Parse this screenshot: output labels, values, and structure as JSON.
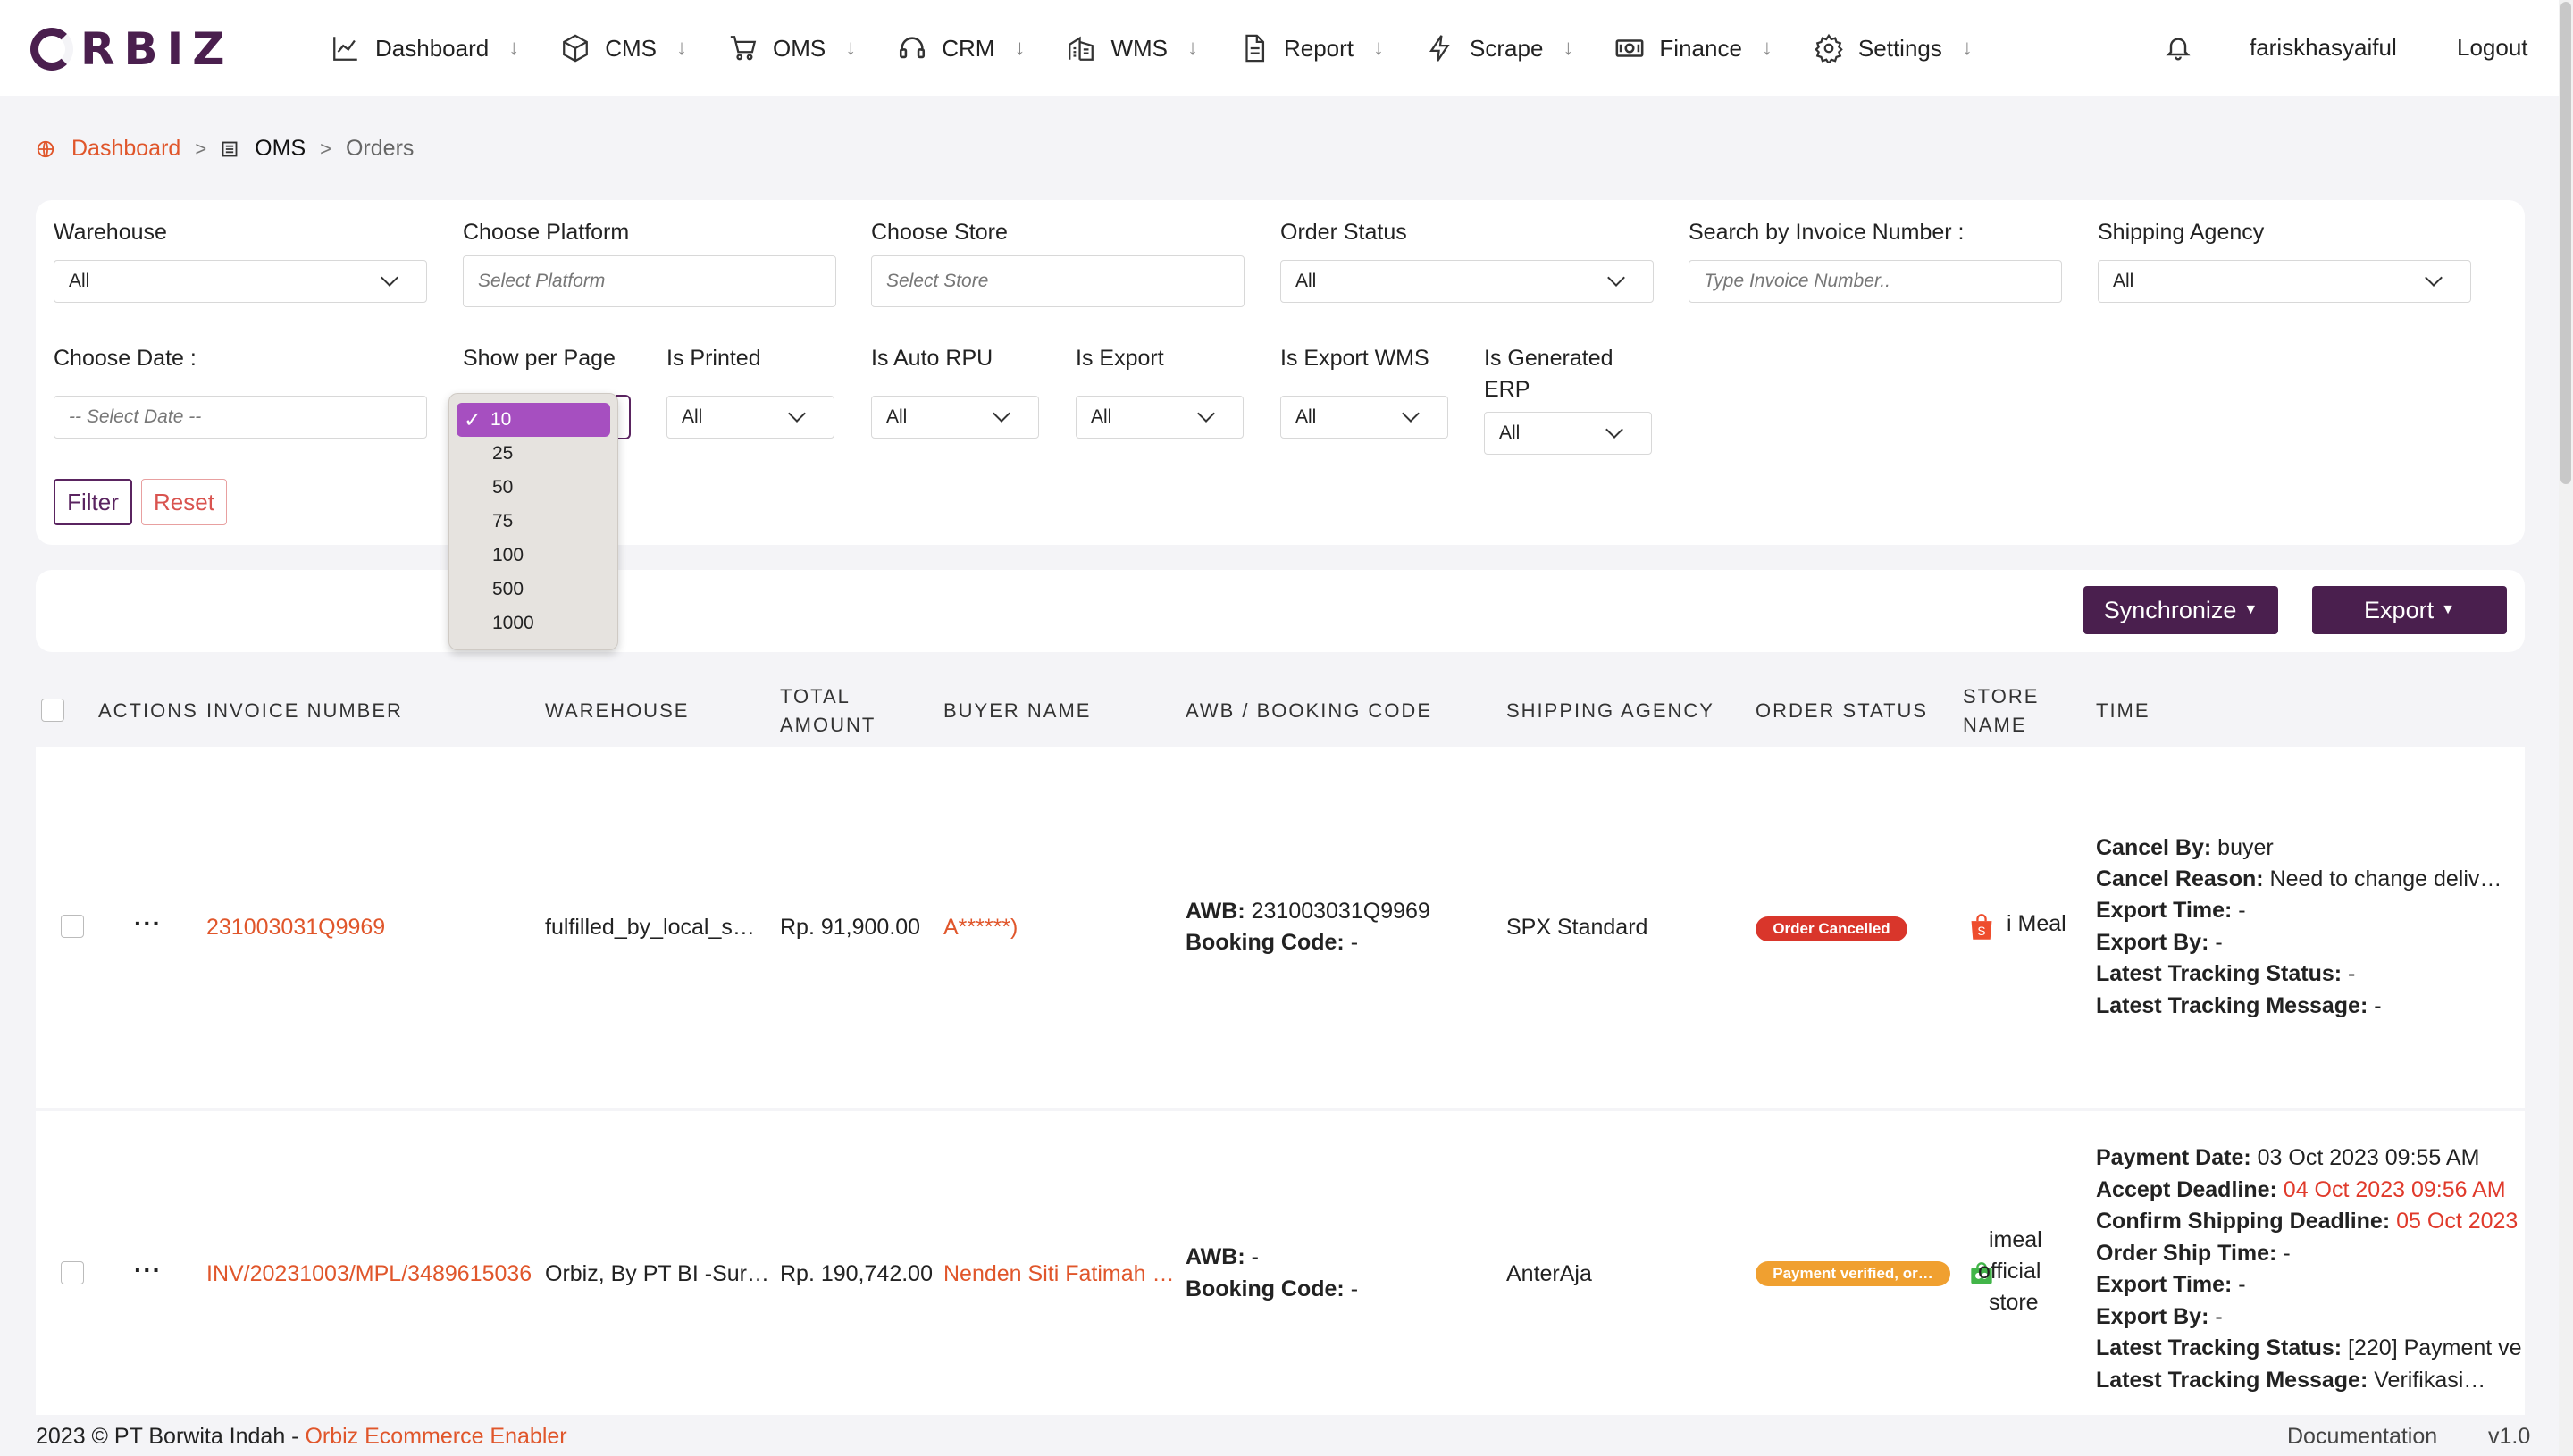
{
  "brand": {
    "logo_text": "RBIZ",
    "color": "#4a1f4e"
  },
  "nav": {
    "items": [
      {
        "label": "Dashboard",
        "icon": "chart-line-icon"
      },
      {
        "label": "CMS",
        "icon": "box-icon"
      },
      {
        "label": "OMS",
        "icon": "cart-icon"
      },
      {
        "label": "CRM",
        "icon": "headset-icon"
      },
      {
        "label": "WMS",
        "icon": "warehouse-icon"
      },
      {
        "label": "Report",
        "icon": "document-icon"
      },
      {
        "label": "Scrape",
        "icon": "bolt-icon"
      },
      {
        "label": "Finance",
        "icon": "money-icon"
      },
      {
        "label": "Settings",
        "icon": "gear-icon"
      }
    ],
    "arrow": "↓",
    "username": "fariskhasyaiful",
    "logout": "Logout"
  },
  "breadcrumb": {
    "home": "Dashboard",
    "section": "OMS",
    "current": "Orders",
    "sep": ">"
  },
  "filters": {
    "warehouse": {
      "label": "Warehouse",
      "value": "All"
    },
    "platform": {
      "label": "Choose Platform",
      "placeholder": "Select Platform"
    },
    "store": {
      "label": "Choose Store",
      "placeholder": "Select Store"
    },
    "order_status": {
      "label": "Order Status",
      "value": "All"
    },
    "invoice": {
      "label": "Search by Invoice Number :",
      "placeholder": "Type Invoice Number.."
    },
    "shipping_agency": {
      "label": "Shipping Agency",
      "value": "All"
    },
    "date": {
      "label": "Choose Date :",
      "placeholder": "-- Select Date --"
    },
    "per_page": {
      "label": "Show per Page",
      "options": [
        "10",
        "25",
        "50",
        "75",
        "100",
        "500",
        "1000"
      ],
      "selected": "10",
      "check": "✓"
    },
    "is_printed": {
      "label": "Is Printed",
      "value": "All"
    },
    "is_auto_rpu": {
      "label": "Is Auto RPU",
      "value": "All"
    },
    "is_export": {
      "label": "Is Export",
      "value": "All"
    },
    "is_export_wms": {
      "label": "Is Export WMS",
      "value": "All"
    },
    "is_generated_erp": {
      "label_line1": "Is Generated",
      "label_line2": "ERP",
      "value": "All"
    },
    "filter_button": "Filter",
    "reset_button": "Reset"
  },
  "actions": {
    "synchronize": "Synchronize",
    "export": "Export"
  },
  "table": {
    "headers": {
      "actions": "ACTIONS",
      "invoice": "INVOICE NUMBER",
      "warehouse": "WAREHOUSE",
      "total_1": "TOTAL",
      "total_2": "AMOUNT",
      "buyer": "BUYER NAME",
      "awb": "AWB / BOOKING CODE",
      "shipping": "SHIPPING AGENCY",
      "status": "ORDER STATUS",
      "store_1": "STORE",
      "store_2": "NAME",
      "time": "TIME"
    },
    "rows": [
      {
        "invoice": "231003031Q9969",
        "warehouse": "fulfilled_by_local_s…",
        "total": "Rp. 91,900.00",
        "buyer": "A******)",
        "awb_label": "AWB:",
        "awb": "231003031Q9969",
        "booking_label": "Booking Code:",
        "booking": "-",
        "shipping": "SPX Standard",
        "status": "Order Cancelled",
        "status_color": "#d9362b",
        "store": "i Meal",
        "store_icon": "shopee-bag-icon",
        "time": [
          {
            "k": "Cancel By:",
            "v": "buyer"
          },
          {
            "k": "Cancel Reason:",
            "v": "Need to change deliv…"
          },
          {
            "k": "Export Time:",
            "v": "-"
          },
          {
            "k": "Export By:",
            "v": "-"
          },
          {
            "k": "Latest Tracking Status:",
            "v": "-"
          },
          {
            "k": "Latest Tracking Message:",
            "v": "-"
          }
        ]
      },
      {
        "invoice": "INV/20231003/MPL/3489615036",
        "warehouse": "Orbiz, By PT BI -Sur…",
        "total": "Rp. 190,742.00",
        "buyer": "Nenden Siti Fatimah …",
        "awb_label": "AWB:",
        "awb": "-",
        "booking_label": "Booking Code:",
        "booking": "-",
        "shipping": "AnterAja",
        "status": "Payment verified, or…",
        "status_color": "#f0a030",
        "store_line1": "imeal",
        "store_line2": "official",
        "store_line3": "store",
        "store_icon": "tokopedia-icon",
        "time": [
          {
            "k": "Payment Date:",
            "v": "03 Oct 2023 09:55 AM"
          },
          {
            "k": "Accept Deadline:",
            "v": "04 Oct 2023 09:56 AM"
          },
          {
            "k": "Confirm Shipping Deadline:",
            "v": "05 Oct 2023"
          },
          {
            "k": "Order Ship Time:",
            "v": "-"
          },
          {
            "k": "Export Time:",
            "v": "-"
          },
          {
            "k": "Export By:",
            "v": "-"
          },
          {
            "k": "Latest Tracking Status:",
            "v": "[220] Payment ve"
          },
          {
            "k": "Latest Tracking Message:",
            "v": "Verifikasi…"
          }
        ]
      }
    ]
  },
  "footer": {
    "copyright": "2023 © PT Borwita Indah - ",
    "company_link": "Orbiz Ecommerce Enabler",
    "documentation": "Documentation",
    "version": "v1.0"
  },
  "colors": {
    "accent": "#e0562b",
    "primary": "#4a1f4e",
    "dropdown_highlight": "#a64fc0"
  }
}
